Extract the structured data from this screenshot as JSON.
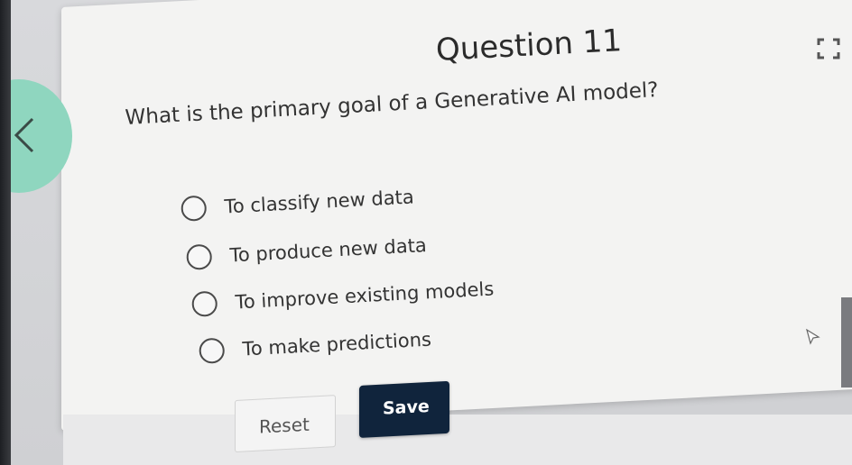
{
  "quiz": {
    "title": "Question 11",
    "question": "What is the primary goal of a Generative AI model?",
    "options": [
      {
        "label": "To classify new data"
      },
      {
        "label": "To produce new data"
      },
      {
        "label": "To improve existing models"
      },
      {
        "label": "To make predictions"
      }
    ]
  },
  "actions": {
    "reset_label": "Reset",
    "save_label": "Save"
  },
  "icons": {
    "prev": "chevron-left-icon",
    "fullscreen": "fullscreen-icon",
    "cursor": "mouse-pointer-icon"
  },
  "colors": {
    "accent": "#8fd6bf",
    "primary_button": "#10243c",
    "card_background": "#f3f3f2"
  }
}
